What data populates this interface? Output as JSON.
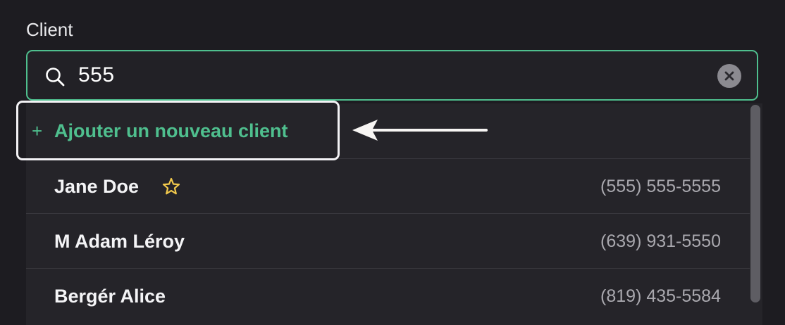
{
  "field": {
    "label": "Client"
  },
  "search": {
    "value": "555",
    "icon": "search-icon",
    "clear_icon": "clear-icon"
  },
  "dropdown": {
    "add_action": {
      "icon": "+",
      "label": "Ajouter un nouveau client"
    },
    "clients": [
      {
        "name": "Jane Doe",
        "phone": "(555) 555-5555",
        "favorite": true
      },
      {
        "name": "M Adam Léroy",
        "phone": "(639) 931-5550",
        "favorite": false
      },
      {
        "name": "Bergér Alice",
        "phone": "(819) 435-5584",
        "favorite": false
      }
    ]
  },
  "colors": {
    "accent_green": "#4fbf8e",
    "background": "#1d1c21",
    "dropdown_bg": "#252429",
    "star_yellow": "#f2c94c"
  }
}
